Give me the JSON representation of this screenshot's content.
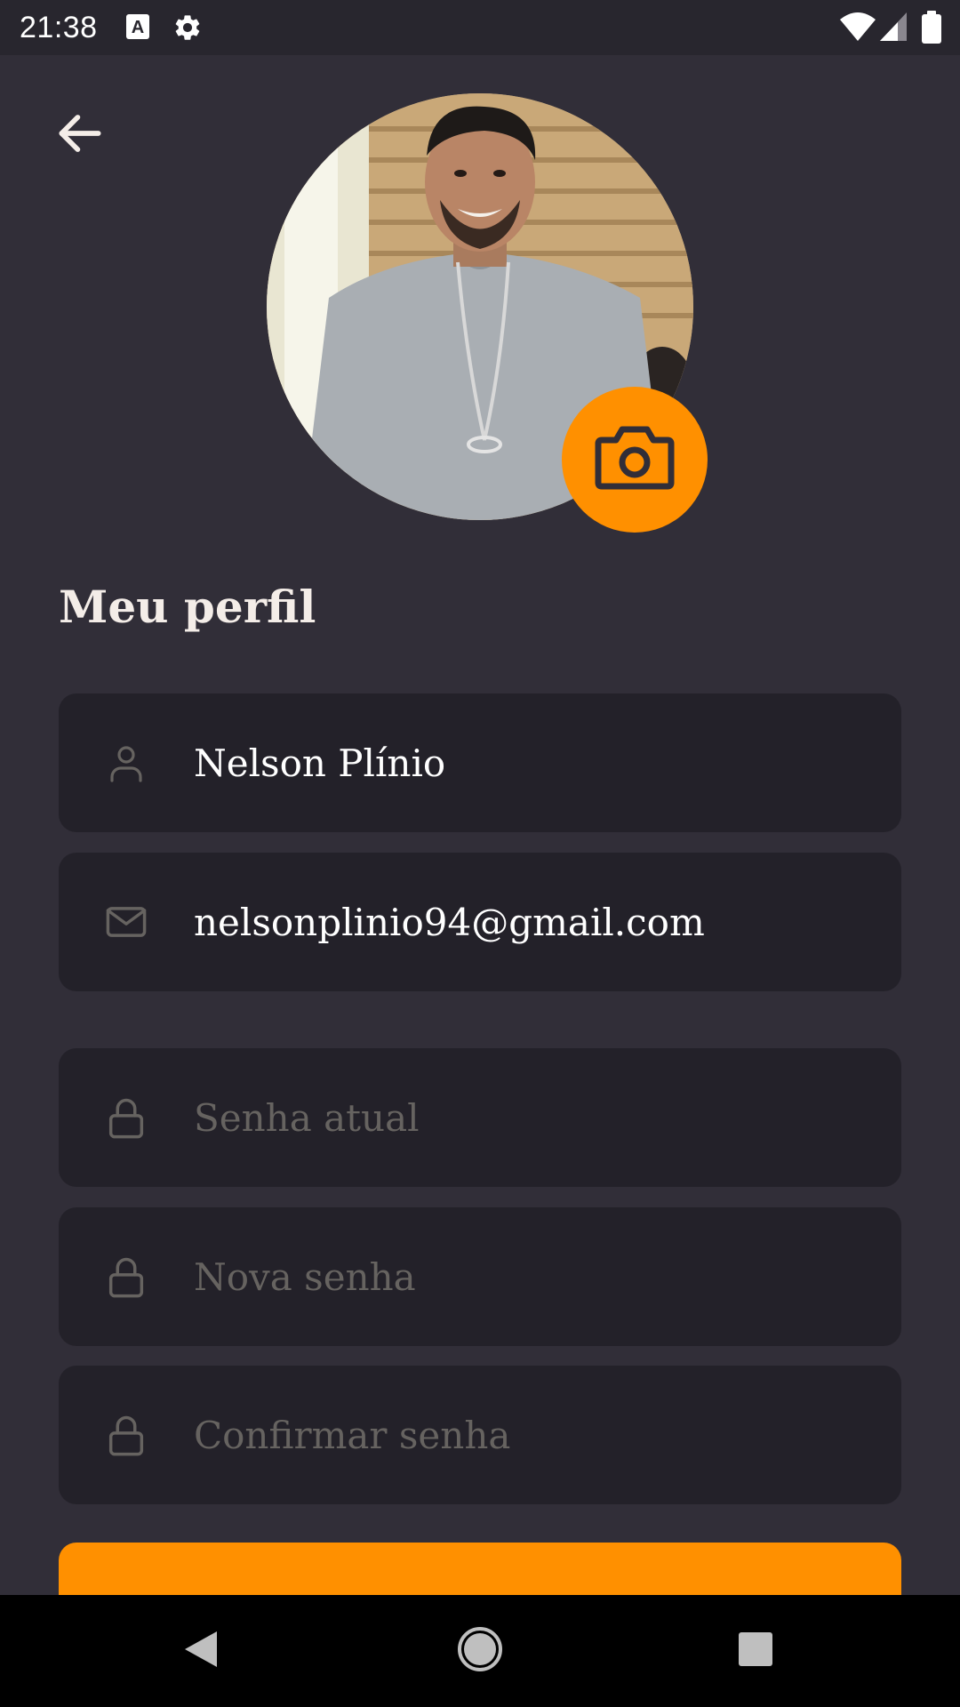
{
  "status_bar": {
    "time": "21:38",
    "icons": [
      "text-input-icon",
      "gear-icon",
      "wifi-icon",
      "cell-signal-icon",
      "battery-icon"
    ]
  },
  "header": {
    "back_icon": "arrow-left-icon",
    "camera_icon": "camera-icon"
  },
  "title": "Meu perfil",
  "form": {
    "name": {
      "value": "Nelson Plínio",
      "icon": "user-icon"
    },
    "email": {
      "value": "nelsonplinio94@gmail.com",
      "icon": "mail-icon"
    },
    "old_password": {
      "placeholder": "Senha atual",
      "icon": "lock-icon"
    },
    "new_password": {
      "placeholder": "Nova senha",
      "icon": "lock-icon"
    },
    "confirm_password": {
      "placeholder": "Confirmar senha",
      "icon": "lock-icon"
    }
  },
  "colors": {
    "background": "#312E38",
    "input_background": "#232129",
    "accent": "#FF9000",
    "title": "#F4EDE8",
    "placeholder": "#666360"
  },
  "nav_bar": {
    "icons": [
      "back-triangle-icon",
      "home-circle-icon",
      "recents-square-icon"
    ]
  }
}
